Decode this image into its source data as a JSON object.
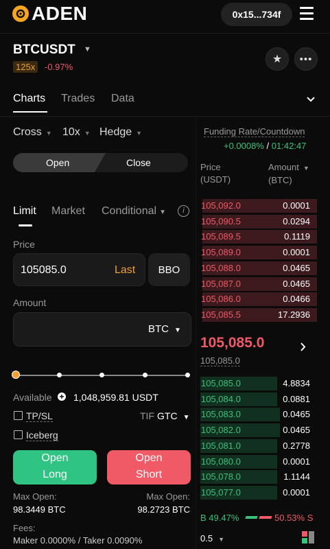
{
  "header": {
    "logo_text": "ADEN",
    "wallet": "0x15...734f"
  },
  "market": {
    "symbol": "BTCUSDT",
    "leverage_badge": "125x",
    "change": "-0.97%"
  },
  "tabs": [
    "Charts",
    "Trades",
    "Data"
  ],
  "settings": {
    "margin_mode": "Cross",
    "leverage": "10x",
    "position_mode": "Hedge"
  },
  "open_close": {
    "open": "Open",
    "close": "Close"
  },
  "order_types": {
    "limit": "Limit",
    "market": "Market",
    "conditional": "Conditional"
  },
  "price": {
    "label": "Price",
    "value": "105085.0",
    "tag": "Last",
    "bbo": "BBO"
  },
  "amount": {
    "label": "Amount",
    "unit": "BTC"
  },
  "available": {
    "label": "Available",
    "value": "1,048,959.81 USDT"
  },
  "options": {
    "tpsl": "TP/SL",
    "tif_label": "TIF",
    "tif_value": "GTC",
    "iceberg": "Iceberg"
  },
  "buttons": {
    "long_l1": "Open",
    "long_l2": "Long",
    "short_l1": "Open",
    "short_l2": "Short"
  },
  "max_open": {
    "label": "Max Open:",
    "long": "98.3449 BTC",
    "short": "98.2723 BTC"
  },
  "fees": {
    "label": "Fees:",
    "maker": "Maker 0.0000%",
    "sep": "/",
    "taker": "Taker 0.0090%"
  },
  "funding": {
    "label": "Funding Rate/Countdown",
    "rate": "+0.0008%",
    "sep": "/",
    "countdown": "01:42:47"
  },
  "book_headers": {
    "price": "Price",
    "price_unit": "(USDT)",
    "amount": "Amount",
    "amount_unit": "(BTC)"
  },
  "asks": [
    {
      "price": "105,092.0",
      "amount": "0.0001",
      "depth": 0.98
    },
    {
      "price": "105,090.5",
      "amount": "0.0294",
      "depth": 0.98
    },
    {
      "price": "105,089.5",
      "amount": "0.1119",
      "depth": 0.98
    },
    {
      "price": "105,089.0",
      "amount": "0.0001",
      "depth": 0.98
    },
    {
      "price": "105,088.0",
      "amount": "0.0465",
      "depth": 0.98
    },
    {
      "price": "105,087.0",
      "amount": "0.0465",
      "depth": 0.98
    },
    {
      "price": "105,086.0",
      "amount": "0.0466",
      "depth": 0.98
    },
    {
      "price": "105,085.5",
      "amount": "17.2936",
      "depth": 0.98
    }
  ],
  "last_price": {
    "value": "105,085.0",
    "mark": "105,085.0"
  },
  "bids": [
    {
      "price": "105,085.0",
      "amount": "4.8834",
      "depth": 0.66
    },
    {
      "price": "105,084.0",
      "amount": "0.0881",
      "depth": 0.66
    },
    {
      "price": "105,083.0",
      "amount": "0.0465",
      "depth": 0.68
    },
    {
      "price": "105,082.0",
      "amount": "0.0465",
      "depth": 0.68
    },
    {
      "price": "105,081.0",
      "amount": "0.2778",
      "depth": 0.66
    },
    {
      "price": "105,080.0",
      "amount": "0.0001",
      "depth": 0.66
    },
    {
      "price": "105,078.0",
      "amount": "1.1144",
      "depth": 0.66
    },
    {
      "price": "105,077.0",
      "amount": "0.0001",
      "depth": 0.66
    }
  ],
  "ratio": {
    "buy_label": "B",
    "buy": "49.47%",
    "sell": "50.53%",
    "sell_label": "S",
    "buy_fraction": 0.4947
  },
  "precision": "0.5",
  "colors": {
    "accent": "#f5a623",
    "ask": "#f05a66",
    "bid": "#39c27a",
    "ask_bg": "#3d1a1e",
    "bid_bg": "#12301f"
  }
}
